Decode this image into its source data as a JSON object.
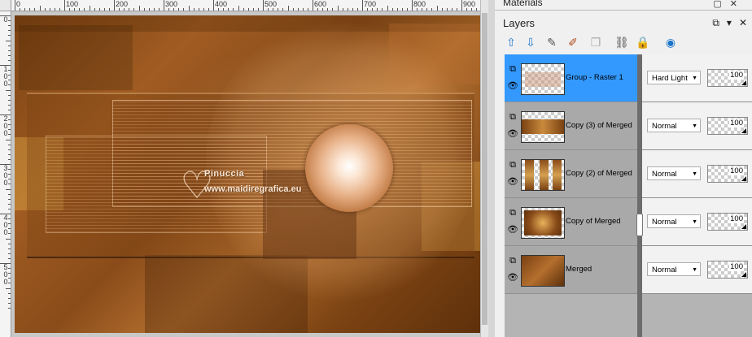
{
  "canvas": {
    "ruler_top_numbers": [
      "0",
      "100",
      "200",
      "300",
      "400",
      "500",
      "600",
      "700",
      "800",
      "900"
    ],
    "ruler_left_numbers": [
      "0",
      "1\n0\n0",
      "2\n0\n0",
      "3\n0\n0",
      "4\n0\n0",
      "5\n0\n0"
    ],
    "watermark_name": "Pinuccia",
    "watermark_url": "www.maidiregrafica.eu"
  },
  "panels": {
    "materials_title": "Materials",
    "layers_title": "Layers"
  },
  "toolbar": [
    {
      "icon": "move-layer-up-icon",
      "glyph": "⇧",
      "color": "#1a74c9"
    },
    {
      "icon": "move-layer-down-icon",
      "glyph": "⇩",
      "color": "#1a74c9"
    },
    {
      "icon": "new-layer-icon",
      "glyph": "✎",
      "color": "#555"
    },
    {
      "icon": "properties-icon",
      "glyph": "✐",
      "color": "#b04a1a"
    },
    {
      "icon": "duplicate-icon",
      "glyph": "❐",
      "color": "#aaa"
    },
    {
      "icon": "link-icon",
      "glyph": "⛓",
      "color": "#444"
    },
    {
      "icon": "lock-icon",
      "glyph": "🔒",
      "color": "#d4a300"
    },
    {
      "icon": "mask-icon",
      "glyph": "◉",
      "color": "#1a74c9"
    }
  ],
  "layers": [
    {
      "name": "Group - Raster 1",
      "blend": "Hard Light",
      "opacity": "100",
      "selected": true,
      "thumb": "group"
    },
    {
      "name": "Copy (3) of Merged",
      "blend": "Normal",
      "opacity": "100",
      "selected": false,
      "thumb": "strip"
    },
    {
      "name": "Copy (2) of Merged",
      "blend": "Normal",
      "opacity": "100",
      "selected": false,
      "thumb": "columns"
    },
    {
      "name": "Copy of Merged",
      "blend": "Normal",
      "opacity": "100",
      "selected": false,
      "thumb": "framed"
    },
    {
      "name": "Merged",
      "blend": "Normal",
      "opacity": "100",
      "selected": false,
      "thumb": "full"
    }
  ]
}
